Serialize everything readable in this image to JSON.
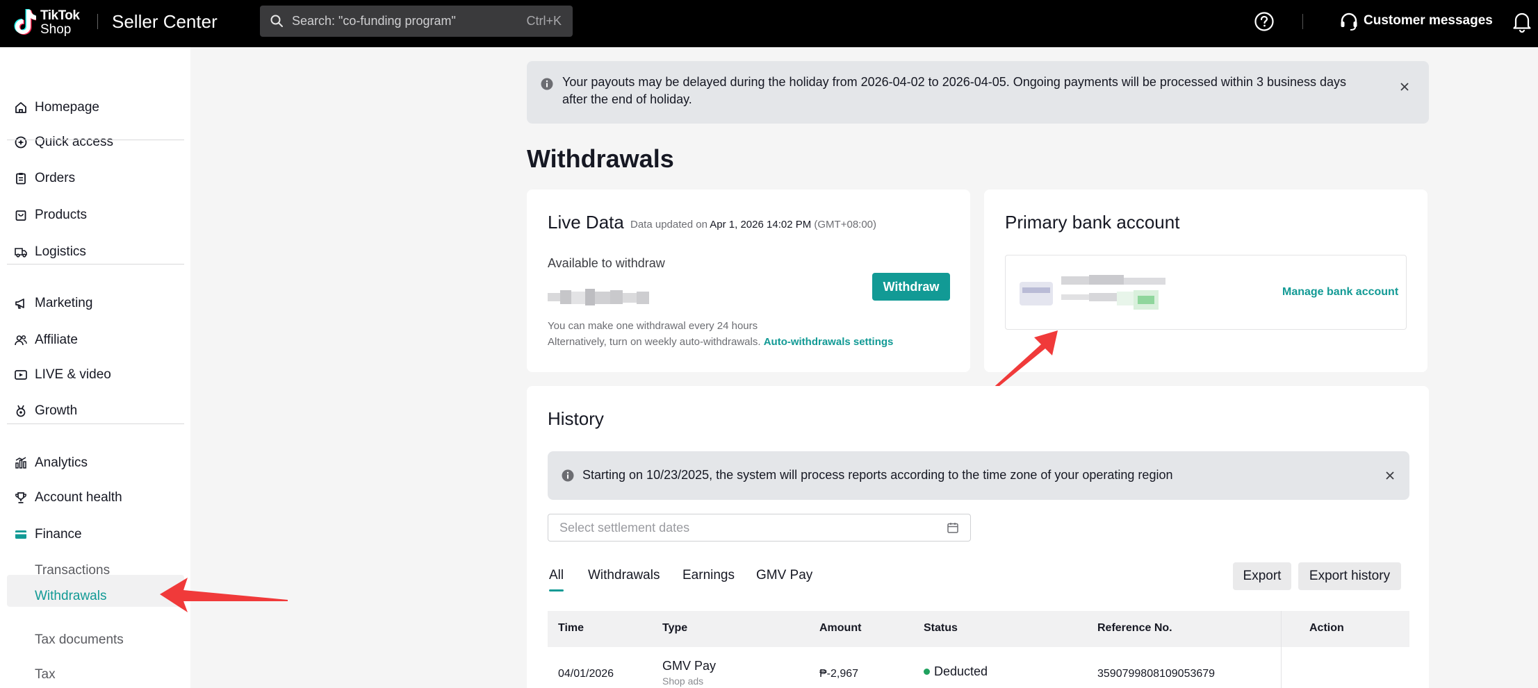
{
  "topbar": {
    "logo_line1": "TikTok",
    "logo_line2": "Shop",
    "app_title": "Seller Center",
    "search_placeholder": "Search: \"co-funding program\"",
    "search_shortcut": "Ctrl+K",
    "customer_messages": "Customer messages"
  },
  "sidebar": {
    "items": [
      {
        "label": "Homepage",
        "icon": "home-icon"
      },
      {
        "label": "Quick access",
        "icon": "quick-access-icon"
      },
      {
        "label": "Orders",
        "icon": "clipboard-icon"
      },
      {
        "label": "Products",
        "icon": "bag-icon"
      },
      {
        "label": "Logistics",
        "icon": "truck-icon"
      },
      {
        "label": "Marketing",
        "icon": "megaphone-icon"
      },
      {
        "label": "Affiliate",
        "icon": "people-icon"
      },
      {
        "label": "LIVE & video",
        "icon": "video-icon"
      },
      {
        "label": "Growth",
        "icon": "medal-icon"
      },
      {
        "label": "Analytics",
        "icon": "bar-chart-icon"
      },
      {
        "label": "Account health",
        "icon": "trophy-icon"
      },
      {
        "label": "Finance",
        "icon": "wallet-icon"
      }
    ],
    "finance_sub": [
      "Transactions",
      "Withdrawals",
      "Tax documents",
      "Tax"
    ],
    "active_item": "Withdrawals"
  },
  "holiday_banner": {
    "text_line1": "Your payouts may be delayed during the holiday from 2026-04-02 to 2026-04-05. Ongoing payments will be processed within 3 business days",
    "text_line2": "after the end of holiday."
  },
  "page_title": "Withdrawals",
  "live_data": {
    "title": "Live Data",
    "updated_prefix": "Data updated on",
    "updated_time": "Apr 1, 2026 14:02 PM",
    "timezone": "(GMT+08:00)",
    "available_label": "Available to withdraw",
    "withdraw_button": "Withdraw",
    "note1": "You can make one withdrawal every 24 hours",
    "note2": "Alternatively, turn on weekly auto-withdrawals.",
    "auto_link": "Auto-withdrawals settings"
  },
  "bank": {
    "title": "Primary bank account",
    "manage_link": "Manage bank account"
  },
  "history": {
    "title": "History",
    "banner_text": "Starting on 10/23/2025, the system will process reports according to the time zone of your operating region",
    "date_placeholder": "Select settlement dates",
    "tabs": [
      "All",
      "Withdrawals",
      "Earnings",
      "GMV Pay"
    ],
    "export": "Export",
    "export_history": "Export history",
    "columns": {
      "time": "Time",
      "type": "Type",
      "amount": "Amount",
      "status": "Status",
      "reference": "Reference No.",
      "action": "Action"
    },
    "rows": [
      {
        "time": "04/01/2026",
        "type": "GMV Pay",
        "subtype": "Shop ads",
        "amount": "₱-2,967",
        "status": "Deducted",
        "reference": "3590799808109053679"
      }
    ]
  },
  "colors": {
    "accent": "#129a95",
    "status_green": "#1fa15e",
    "arrow_red": "#f03a3a"
  }
}
